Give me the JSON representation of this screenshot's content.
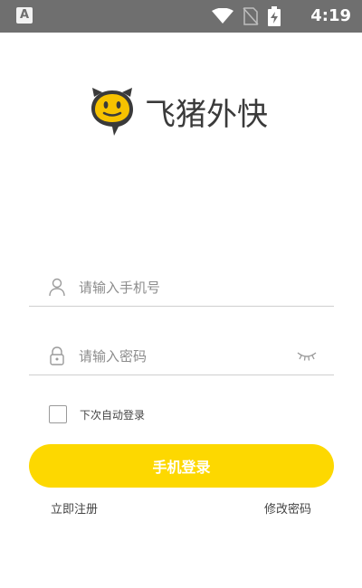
{
  "status_bar": {
    "time": "4:19",
    "left_icon_glyph": "A",
    "icons": [
      "wifi-icon",
      "no-sim-icon",
      "battery-charging-icon"
    ]
  },
  "logo": {
    "text": "飞猪外快"
  },
  "form": {
    "phone_placeholder": "请输入手机号",
    "password_placeholder": "请输入密码",
    "remember_label": "下次自动登录",
    "remember_checked": false,
    "login_button": "手机登录"
  },
  "links": {
    "register": "立即注册",
    "change_password": "修改密码"
  },
  "colors": {
    "accent": "#fdd800",
    "status_bar": "#6f6f6f",
    "logo_body": "#f7c200",
    "logo_dark": "#3a3a3a"
  }
}
